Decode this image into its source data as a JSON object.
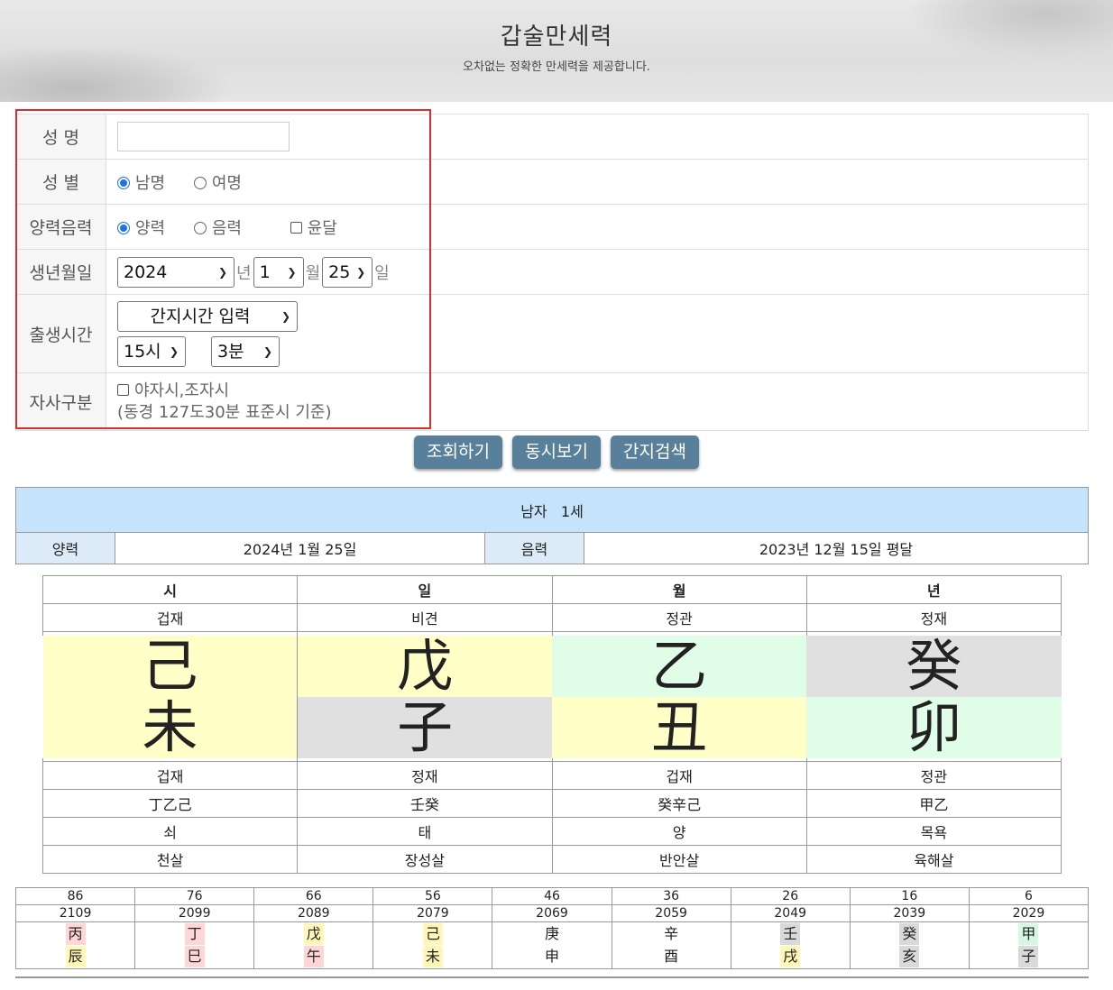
{
  "header": {
    "title": "갑술만세력",
    "subtitle": "오차없는 정확한 만세력을 제공합니다."
  },
  "form": {
    "name_label": "성 명",
    "name_value": "",
    "gender_label": "성 별",
    "gender_male": "남명",
    "gender_female": "여명",
    "gender_selected": "남명",
    "calendar_label": "양력음력",
    "cal_solar": "양력",
    "cal_lunar": "음력",
    "cal_leap": "윤달",
    "calendar_selected": "양력",
    "birthdate_label": "생년월일",
    "year": "2024",
    "year_suffix": "년",
    "month": "1",
    "month_suffix": "월",
    "day": "25",
    "day_suffix": "일",
    "birthtime_label": "출생시간",
    "time_mode": "간지시간 입력",
    "hour": "15시",
    "minute": "3분",
    "jasi_label": "자사구분",
    "jasi_option": "야자시,조자시",
    "jasi_note": "(동경 127도30분 표준시 기준)"
  },
  "buttons": {
    "search": "조회하기",
    "same_time": "동시보기",
    "ganji_search": "간지검색"
  },
  "info": {
    "gender_age": "남자   1세",
    "solar_label": "양력",
    "solar_date": "2024년 1월 25일",
    "lunar_label": "음력",
    "lunar_date": "2023년 12월 15일 평달"
  },
  "pillars": {
    "headers": [
      "시",
      "일",
      "월",
      "년"
    ],
    "stem_gods": [
      "겁재",
      "비견",
      "정관",
      "정재"
    ],
    "stems": [
      "己",
      "戊",
      "乙",
      "癸"
    ],
    "branches": [
      "未",
      "子",
      "丑",
      "卯"
    ],
    "branch_gods": [
      "겁재",
      "정재",
      "겁재",
      "정관"
    ],
    "hidden": [
      "丁乙己",
      "壬癸",
      "癸辛己",
      "甲乙"
    ],
    "stages": [
      "쇠",
      "태",
      "양",
      "목욕"
    ],
    "spirits": [
      "천살",
      "장성살",
      "반안살",
      "육해살"
    ],
    "colors": {
      "yellow": "#ffffc8",
      "mint": "#e0fde8",
      "gray": "#e0e0e0"
    }
  },
  "luck": {
    "ages": [
      "86",
      "76",
      "66",
      "56",
      "46",
      "36",
      "26",
      "16",
      "6"
    ],
    "years": [
      "2109",
      "2099",
      "2089",
      "2079",
      "2069",
      "2059",
      "2049",
      "2039",
      "2029"
    ],
    "stems": [
      "丙",
      "丁",
      "戊",
      "己",
      "庚",
      "辛",
      "壬",
      "癸",
      "甲"
    ],
    "branches": [
      "辰",
      "巳",
      "午",
      "未",
      "申",
      "酉",
      "戌",
      "亥",
      "子"
    ]
  }
}
